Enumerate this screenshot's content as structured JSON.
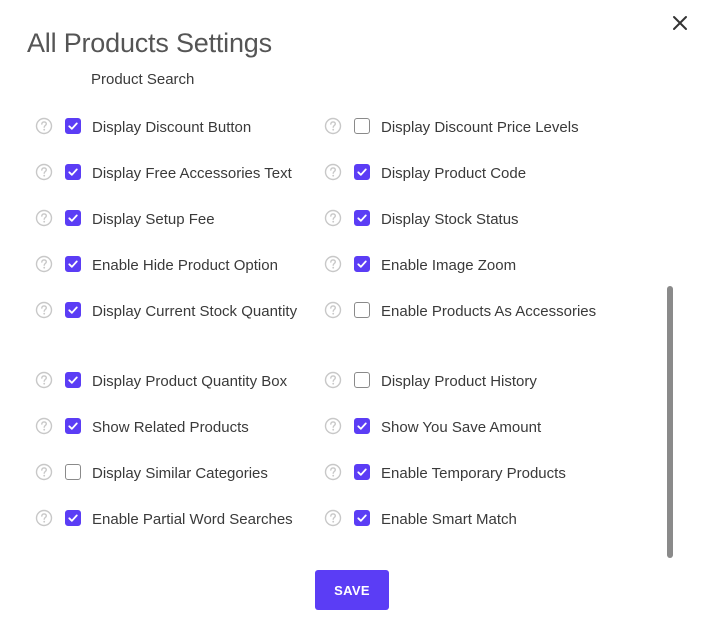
{
  "dialog": {
    "title": "All Products Settings",
    "section_heading": "Product Search",
    "save_label": "SAVE",
    "accent_color": "#5b3df5"
  },
  "settings": [
    {
      "label": "Display Discount Button",
      "checked": true
    },
    {
      "label": "Display Discount Price Levels",
      "checked": false
    },
    {
      "label": "Display Free Accessories Text",
      "checked": true
    },
    {
      "label": "Display Product Code",
      "checked": true
    },
    {
      "label": "Display Setup Fee",
      "checked": true
    },
    {
      "label": "Display Stock Status",
      "checked": true
    },
    {
      "label": "Enable Hide Product Option",
      "checked": true
    },
    {
      "label": "Enable Image Zoom",
      "checked": true
    },
    {
      "label": "Display Current Stock Quantity",
      "checked": true
    },
    {
      "label": "Enable Products As Accessories",
      "checked": false
    },
    {
      "label": "Display Product Quantity Box",
      "checked": true
    },
    {
      "label": "Display Product History",
      "checked": false
    },
    {
      "label": "Show Related Products",
      "checked": true
    },
    {
      "label": "Show You Save Amount",
      "checked": true
    },
    {
      "label": "Display Similar Categories",
      "checked": false
    },
    {
      "label": "Enable Temporary Products",
      "checked": true
    },
    {
      "label": "Enable Partial Word Searches",
      "checked": true
    },
    {
      "label": "Enable Smart Match",
      "checked": true
    }
  ]
}
